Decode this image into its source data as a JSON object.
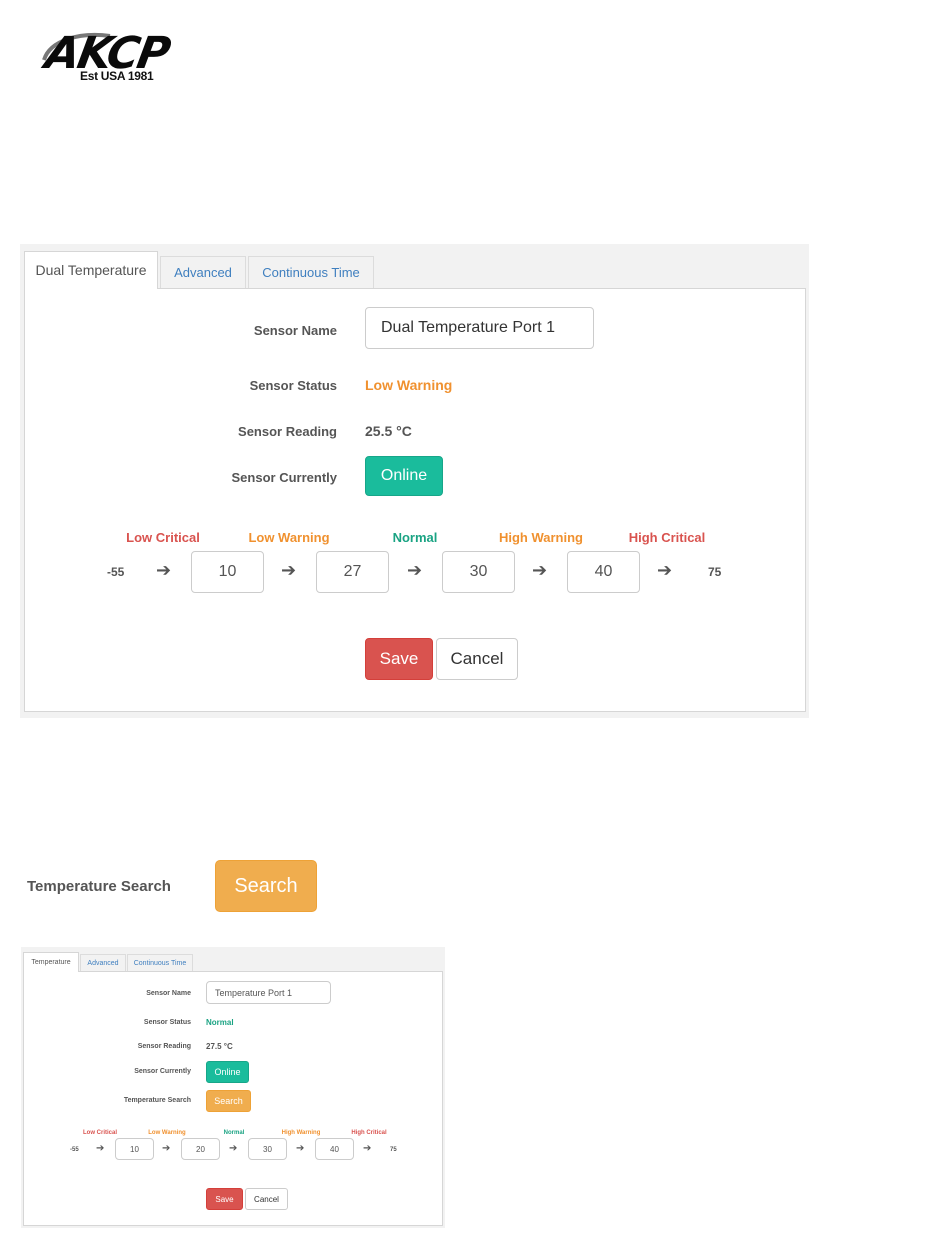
{
  "logo": {
    "name": "AKCP",
    "tagline": "Est USA 1981"
  },
  "colors": {
    "low_critical": "#d9534f",
    "low_warning": "#f0912f",
    "normal": "#1aa383",
    "high_warning": "#f0912f",
    "high_critical": "#d9534f",
    "online": "#1abc9c",
    "search": "#f0ad4e",
    "save": "#d9534f"
  },
  "panel1": {
    "tabs": [
      {
        "label": "Dual Temperature",
        "active": true
      },
      {
        "label": "Advanced",
        "active": false
      },
      {
        "label": "Continuous Time",
        "active": false
      }
    ],
    "sensor_name_label": "Sensor Name",
    "sensor_name_value": "Dual Temperature Port 1",
    "sensor_status_label": "Sensor Status",
    "sensor_status_value": "Low Warning",
    "sensor_reading_label": "Sensor Reading",
    "sensor_reading_value": "25.5 °C",
    "sensor_currently_label": "Sensor Currently",
    "online_button": "Online",
    "thresholds": {
      "labels": [
        "Low Critical",
        "Low Warning",
        "Normal",
        "High Warning",
        "High Critical"
      ],
      "min": "-55",
      "values": [
        "10",
        "27",
        "30",
        "40"
      ],
      "max": "75"
    },
    "save_button": "Save",
    "cancel_button": "Cancel"
  },
  "temperature_search": {
    "label": "Temperature Search",
    "button": "Search"
  },
  "panel2": {
    "tabs": [
      {
        "label": "Temperature",
        "active": true
      },
      {
        "label": "Advanced",
        "active": false
      },
      {
        "label": "Continuous Time",
        "active": false
      }
    ],
    "sensor_name_label": "Sensor Name",
    "sensor_name_value": "Temperature Port 1",
    "sensor_status_label": "Sensor Status",
    "sensor_status_value": "Normal",
    "sensor_reading_label": "Sensor Reading",
    "sensor_reading_value": "27.5 °C",
    "sensor_currently_label": "Sensor Currently",
    "online_button": "Online",
    "temperature_search_label": "Temperature Search",
    "search_button": "Search",
    "thresholds": {
      "labels": [
        "Low Critical",
        "Low Warning",
        "Normal",
        "High Warning",
        "High Critical"
      ],
      "min": "-55",
      "values": [
        "10",
        "20",
        "30",
        "40"
      ],
      "max": "75"
    },
    "save_button": "Save",
    "cancel_button": "Cancel"
  }
}
